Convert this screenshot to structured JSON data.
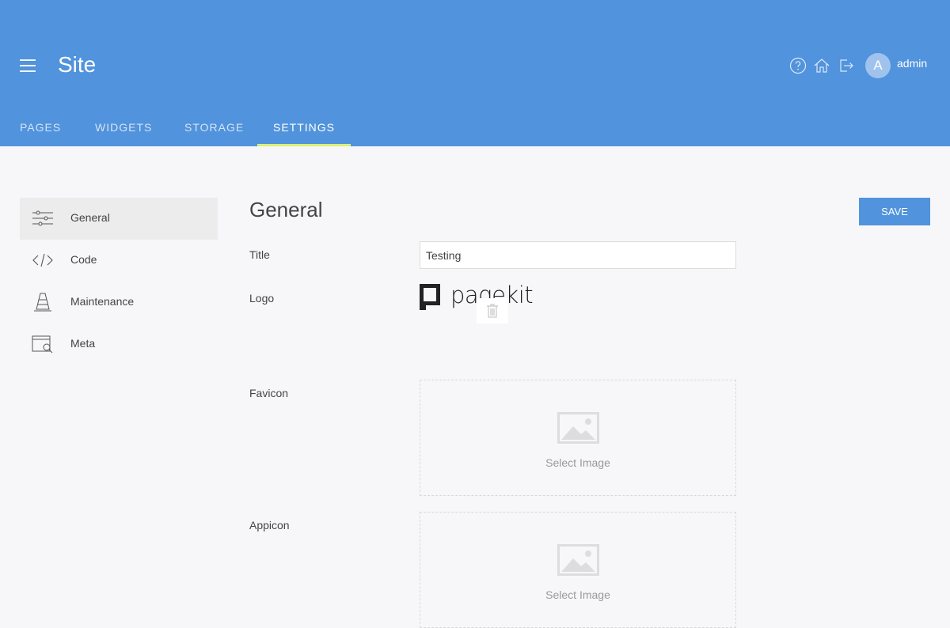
{
  "header": {
    "title": "Site",
    "user": {
      "initial": "A",
      "name": "admin"
    },
    "icons": [
      "help-icon",
      "home-icon",
      "logout-icon"
    ],
    "accent_color": "#5193dc"
  },
  "tabs": [
    {
      "label": "PAGES",
      "active": false
    },
    {
      "label": "WIDGETS",
      "active": false
    },
    {
      "label": "STORAGE",
      "active": false
    },
    {
      "label": "SETTINGS",
      "active": true
    }
  ],
  "sidebar": {
    "items": [
      {
        "label": "General",
        "icon": "sliders-icon",
        "active": true
      },
      {
        "label": "Code",
        "icon": "code-icon",
        "active": false
      },
      {
        "label": "Maintenance",
        "icon": "traffic-cone-icon",
        "active": false
      },
      {
        "label": "Meta",
        "icon": "browser-search-icon",
        "active": false
      }
    ]
  },
  "main": {
    "title": "General",
    "save_label": "SAVE",
    "fields": {
      "title": {
        "label": "Title",
        "value": "Testing"
      },
      "logo": {
        "label": "Logo",
        "image_text": "pagekit"
      },
      "favicon": {
        "label": "Favicon",
        "select_label": "Select Image"
      },
      "appicon": {
        "label": "Appicon",
        "select_label": "Select Image"
      }
    }
  }
}
